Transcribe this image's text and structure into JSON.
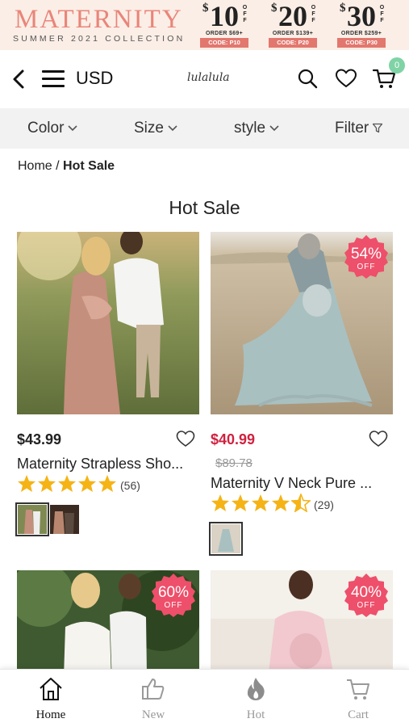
{
  "banner": {
    "brand": "MATERNITY",
    "subtitle": "SUMMER 2021 COLLECTION",
    "coupons": [
      {
        "amount": "10",
        "order": "ORDER $69+",
        "code": "CODE: P10"
      },
      {
        "amount": "20",
        "order": "ORDER $139+",
        "code": "CODE: P20"
      },
      {
        "amount": "30",
        "order": "ORDER $259+",
        "code": "CODE: P30"
      }
    ],
    "colors": {
      "background": "#fbeee6",
      "brand": "#e9857a",
      "code_bg": "#e2776e"
    }
  },
  "header": {
    "currency": "USD",
    "logo": "lulalula",
    "cart_count": "0",
    "icons": [
      "back-icon",
      "menu-icon",
      "search-icon",
      "heart-icon",
      "cart-icon"
    ]
  },
  "filters": [
    {
      "label": "Color"
    },
    {
      "label": "Size"
    },
    {
      "label": "style"
    },
    {
      "label": "Filter"
    }
  ],
  "breadcrumb": {
    "home": "Home",
    "separator": "/",
    "current": "Hot Sale"
  },
  "page_title": "Hot Sale",
  "products": [
    {
      "price": "$43.99",
      "title": "Maternity Strapless Sho...",
      "rating": 5,
      "reviews": "(56)",
      "thumbs": 2
    },
    {
      "price": "$40.99",
      "original_price": "$89.78",
      "discount": "54%",
      "off": "OFF",
      "title": "Maternity V Neck Pure ...",
      "rating": 4.5,
      "reviews": "(29)",
      "thumbs": 1
    },
    {
      "discount": "60%",
      "off": "OFF"
    },
    {
      "discount": "40%",
      "off": "OFF"
    }
  ],
  "bottom_nav": [
    {
      "label": "Home",
      "active": true
    },
    {
      "label": "New"
    },
    {
      "label": "Hot"
    },
    {
      "label": "Cart"
    }
  ],
  "colors": {
    "sale_price": "#d0213f",
    "badge": "#ee4f6a",
    "star": "#f5b315",
    "filter_bg": "#f2f2f2"
  }
}
